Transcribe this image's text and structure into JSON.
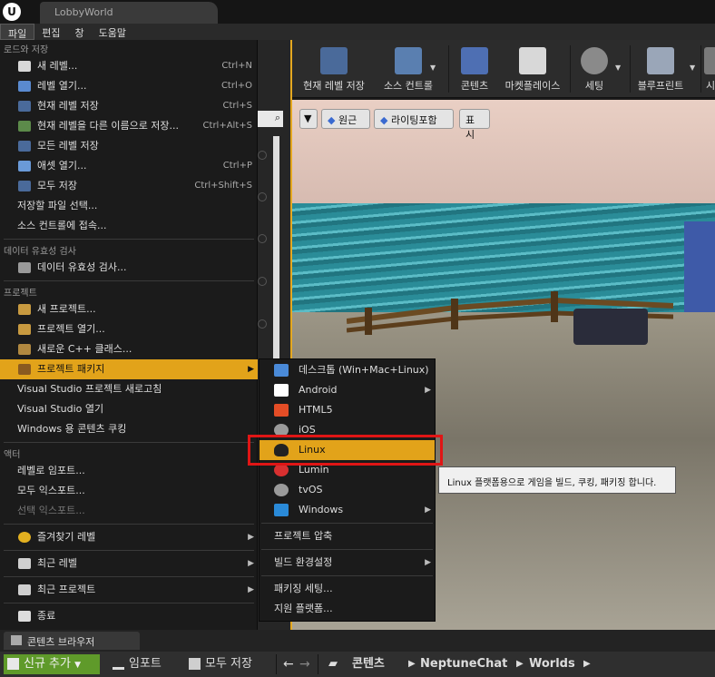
{
  "window": {
    "tab_title": "LobbyWorld"
  },
  "menubar": {
    "items": [
      "파일",
      "편집",
      "창",
      "도움말"
    ]
  },
  "toolbar": {
    "buttons": [
      "현재 레벨 저장",
      "소스 컨트롤",
      "콘텐츠",
      "마켓플레이스",
      "세팅",
      "블루프린트",
      "시"
    ]
  },
  "viewport_toolbar": {
    "perspective": "원근",
    "lighting": "라이팅포함",
    "show": "표시"
  },
  "file_menu": {
    "sections": {
      "load_save": "로드와 저장",
      "data_validation": "데이터 유효성 검사",
      "project": "프로젝트",
      "actor": "액터"
    },
    "items": {
      "new_level": "새 레벨...",
      "new_level_sc": "Ctrl+N",
      "open_level": "레벨 열기...",
      "open_level_sc": "Ctrl+O",
      "save_current": "현재 레벨 저장",
      "save_current_sc": "Ctrl+S",
      "save_as": "현재 레벨을 다른 이름으로 저장...",
      "save_as_sc": "Ctrl+Alt+S",
      "save_all_levels": "모든 레벨 저장",
      "open_asset": "애셋 열기...",
      "open_asset_sc": "Ctrl+P",
      "save_all": "모두 저장",
      "save_all_sc": "Ctrl+Shift+S",
      "choose_files": "저장할 파일 선택...",
      "connect_sc": "소스 컨트롤에 접속...",
      "validate_data": "데이터 유효성 검사...",
      "new_project": "새 프로젝트...",
      "open_project": "프로젝트 열기...",
      "new_cpp": "새로운 C++ 클래스...",
      "package_project": "프로젝트 패키지",
      "refresh_vs": "Visual Studio 프로젝트 새로고침",
      "open_vs": "Visual Studio 열기",
      "cook_windows": "Windows 용 콘텐츠 쿠킹",
      "import_level": "레벨로 임포트...",
      "export_all": "모두 익스포트...",
      "export_selected": "선택 익스포트...",
      "favorite_levels": "즐겨찾기 레벨",
      "recent_levels": "최근 레벨",
      "recent_projects": "최근 프로젝트",
      "exit": "종료"
    }
  },
  "package_submenu": {
    "desktop": "데스크톱 (Win+Mac+Linux)",
    "android": "Android",
    "html5": "HTML5",
    "ios": "iOS",
    "linux": "Linux",
    "lumin": "Lumin",
    "tvos": "tvOS",
    "windows": "Windows",
    "zip_project": "프로젝트 압축",
    "build_config": "빌드 환경설정",
    "packaging_settings": "패키징 세팅...",
    "supported_platforms": "지원 플랫폼..."
  },
  "tooltip": {
    "text": "Linux 플랫폼용으로 게임을 빌드, 쿠킹, 패키징 합니다."
  },
  "content_browser": {
    "tab_label": "콘텐츠 브라우저",
    "add_new": "신규 추가",
    "import": "임포트",
    "save_all": "모두 저장",
    "breadcrumbs": [
      "콘텐츠",
      "NeptuneChat",
      "Worlds"
    ]
  },
  "colors": {
    "highlight": "#e2a31a",
    "focus_outline": "#e01515",
    "add_button": "#5f9a2a"
  }
}
